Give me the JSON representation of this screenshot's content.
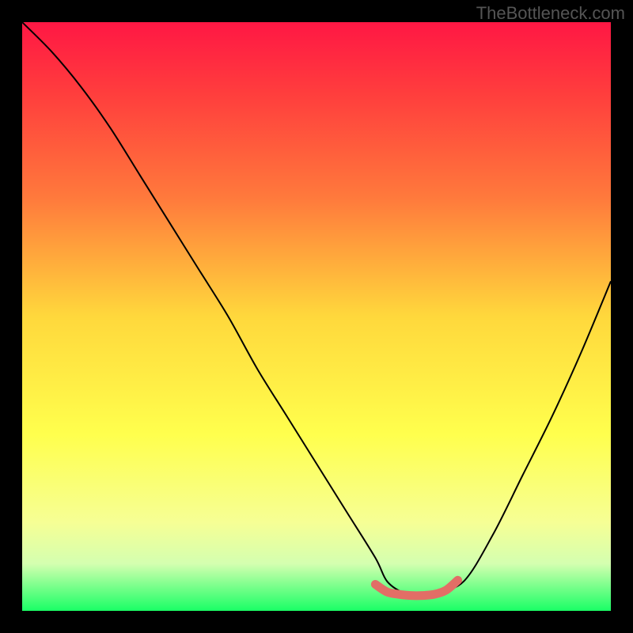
{
  "watermark": "TheBottleneck.com",
  "chart_data": {
    "type": "line",
    "title": "",
    "xlabel": "",
    "ylabel": "",
    "xlim": [
      0,
      100
    ],
    "ylim": [
      0,
      100
    ],
    "series": [
      {
        "name": "bottleneck-curve",
        "x": [
          0,
          5,
          10,
          15,
          20,
          25,
          30,
          35,
          40,
          45,
          50,
          55,
          60,
          62,
          65,
          68,
          70,
          75,
          80,
          85,
          90,
          95,
          100
        ],
        "values": [
          100,
          95,
          89,
          82,
          74,
          66,
          58,
          50,
          41,
          33,
          25,
          17,
          9,
          5,
          3,
          3,
          3,
          5,
          13,
          23,
          33,
          44,
          56
        ]
      },
      {
        "name": "optimal-range-marker",
        "x": [
          60,
          62,
          64,
          66,
          68,
          70,
          72,
          74
        ],
        "values": [
          4.5,
          3.2,
          2.8,
          2.6,
          2.6,
          2.8,
          3.5,
          5.2
        ]
      }
    ],
    "gradient_stops": [
      {
        "offset": 0,
        "color": "#ff1744"
      },
      {
        "offset": 12,
        "color": "#ff3d3d"
      },
      {
        "offset": 30,
        "color": "#ff7a3c"
      },
      {
        "offset": 50,
        "color": "#ffd83c"
      },
      {
        "offset": 70,
        "color": "#ffff4d"
      },
      {
        "offset": 85,
        "color": "#f6ff95"
      },
      {
        "offset": 92,
        "color": "#d4ffb0"
      },
      {
        "offset": 96,
        "color": "#76ff8a"
      },
      {
        "offset": 100,
        "color": "#1aff66"
      }
    ],
    "marker_color": "#e26e66",
    "curve_color": "#000000"
  }
}
